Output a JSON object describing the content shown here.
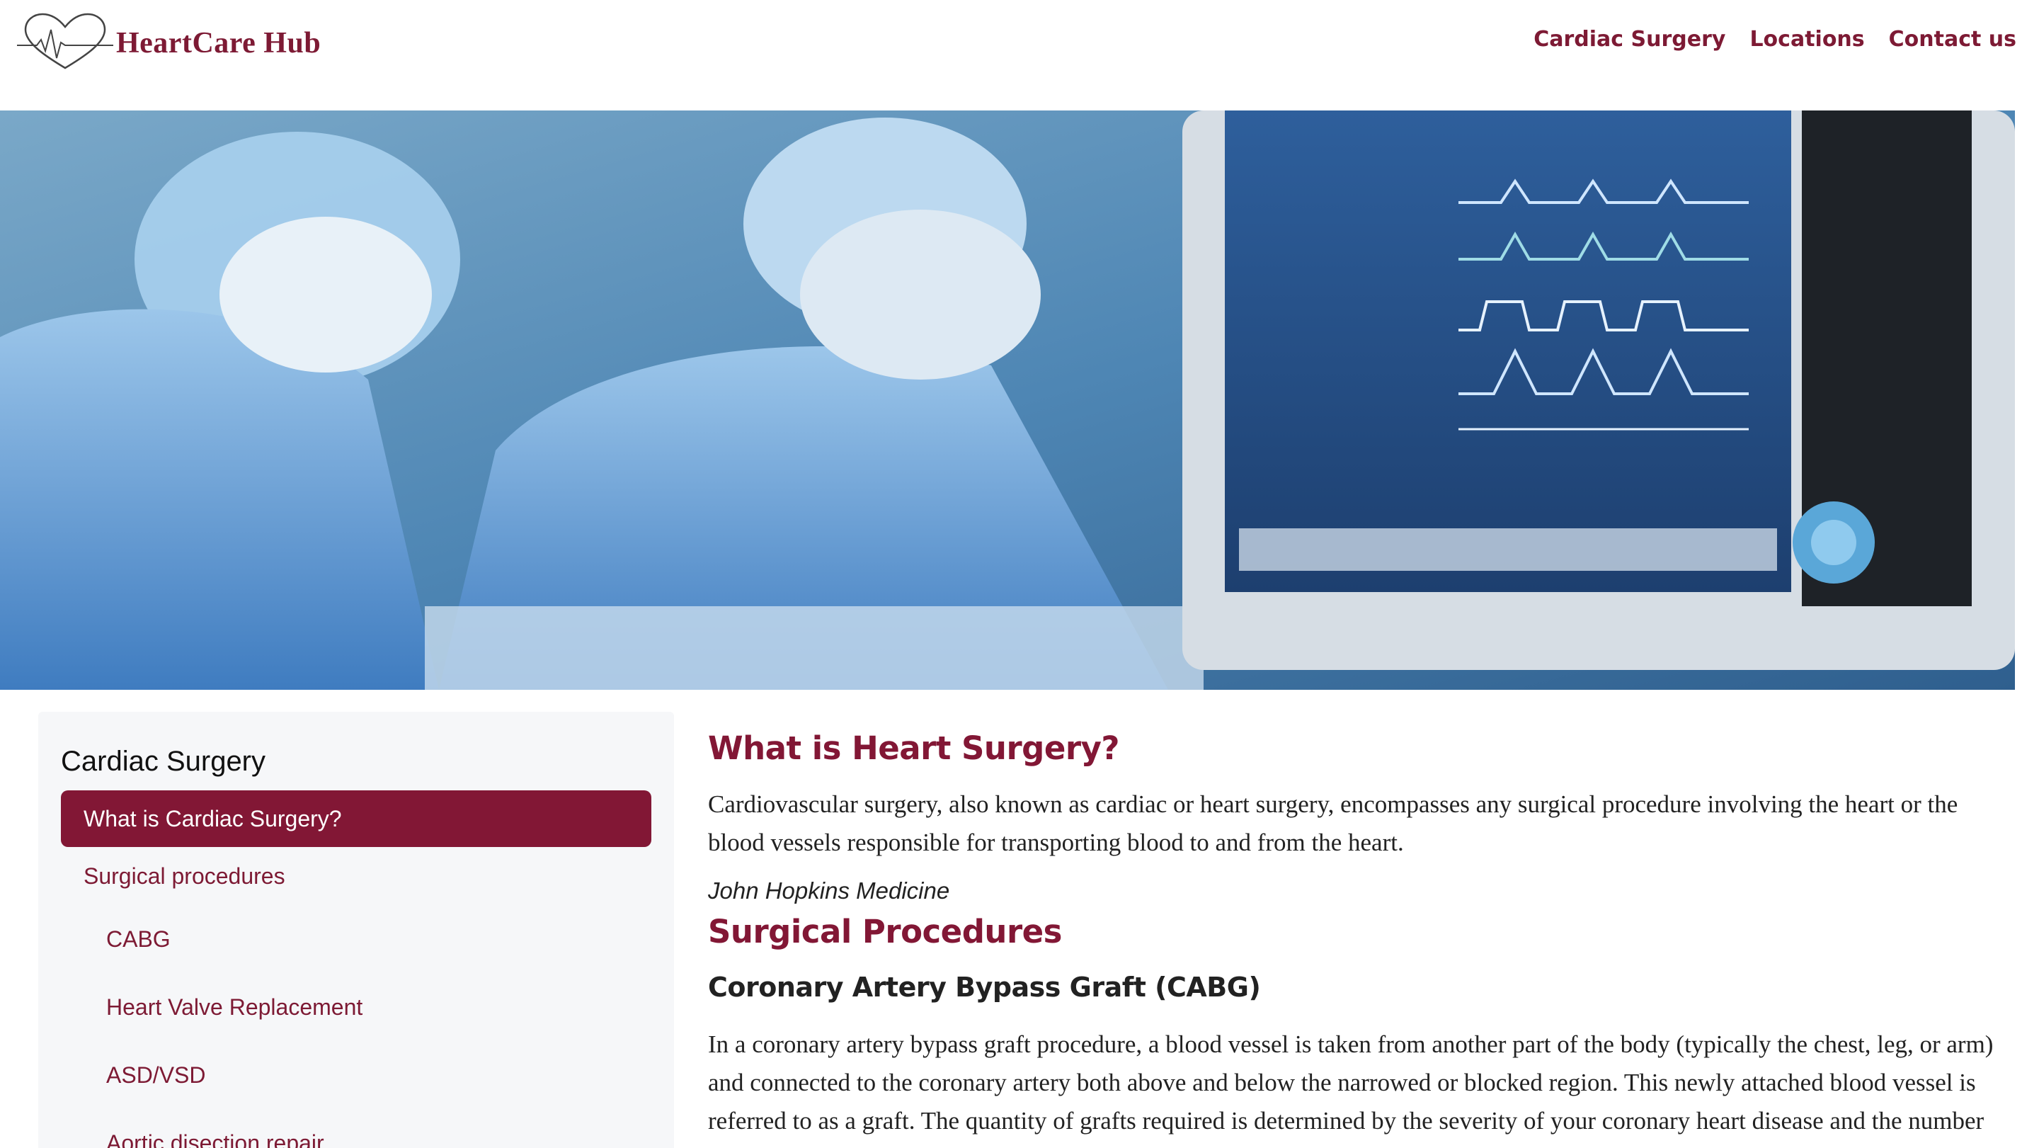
{
  "brand": {
    "name": "HeartCare Hub",
    "logo_icon": "heart-ecg-icon"
  },
  "nav": {
    "items": [
      {
        "label": "Cardiac Surgery"
      },
      {
        "label": "Locations"
      },
      {
        "label": "Contact us"
      }
    ]
  },
  "hero": {
    "image": "surgeons-with-monitor-photo"
  },
  "sidebar": {
    "title": "Cardiac Surgery",
    "items": [
      {
        "label": "What is Cardiac Surgery?",
        "level": 0,
        "active": true
      },
      {
        "label": "Surgical procedures",
        "level": 1
      },
      {
        "label": "CABG",
        "level": 2
      },
      {
        "label": "Heart Valve Replacement",
        "level": 2
      },
      {
        "label": "ASD/VSD",
        "level": 2
      },
      {
        "label": "Aortic disection repair",
        "level": 2
      }
    ]
  },
  "main": {
    "heading": "What is Heart Surgery?",
    "intro": "Cardiovascular surgery, also known as cardiac or heart surgery, encompasses any surgical procedure involving the heart or the blood vessels responsible for transporting blood to and from the heart.",
    "citation": "John Hopkins Medicine",
    "section_heading": "Surgical Procedures",
    "subheading": "Coronary Artery Bypass Graft (CABG)",
    "cabg_text": "In a coronary artery bypass graft procedure, a blood vessel is taken from another part of the body (typically the chest, leg, or arm) and connected to the coronary artery both above and below the narrowed or blocked region. This newly attached blood vessel is referred to as a graft. The quantity of grafts required is determined by the severity of your coronary heart disease and the number"
  },
  "colors": {
    "accent": "#821735",
    "sidebar_bg": "#f6f7f9"
  }
}
